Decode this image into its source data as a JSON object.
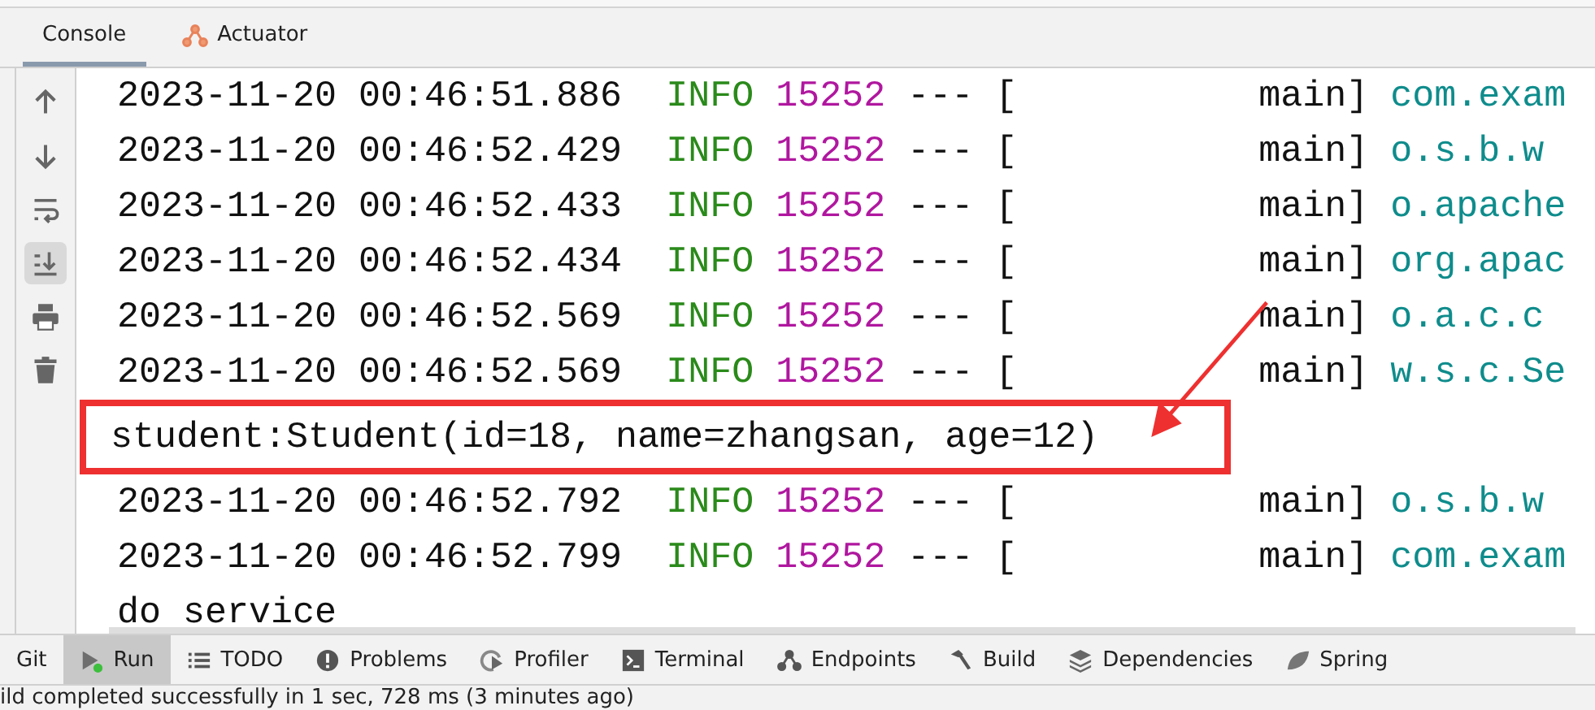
{
  "tabs": [
    {
      "label": "Console",
      "selected": true
    },
    {
      "label": "Actuator",
      "selected": false
    }
  ],
  "toolbar": [
    {
      "kind": "up",
      "on": false
    },
    {
      "kind": "down",
      "on": false
    },
    {
      "kind": "wrap",
      "on": false
    },
    {
      "kind": "scroll-end",
      "on": true
    },
    {
      "kind": "print",
      "on": false
    },
    {
      "kind": "trash",
      "on": false
    }
  ],
  "lines": [
    {
      "kind": "log",
      "highlighted": false,
      "time": "2023-11-20 00:46:51.886",
      "level": "INFO",
      "pid": "15252",
      "thread": "--- [           main]",
      "logger": "com.exam"
    },
    {
      "kind": "log",
      "highlighted": false,
      "time": "2023-11-20 00:46:52.429",
      "level": "INFO",
      "pid": "15252",
      "thread": "--- [           main]",
      "logger": "o.s.b.w"
    },
    {
      "kind": "log",
      "highlighted": false,
      "time": "2023-11-20 00:46:52.433",
      "level": "INFO",
      "pid": "15252",
      "thread": "--- [           main]",
      "logger": "o.apache"
    },
    {
      "kind": "log",
      "highlighted": false,
      "time": "2023-11-20 00:46:52.434",
      "level": "INFO",
      "pid": "15252",
      "thread": "--- [           main]",
      "logger": "org.apac"
    },
    {
      "kind": "log",
      "highlighted": false,
      "time": "2023-11-20 00:46:52.569",
      "level": "INFO",
      "pid": "15252",
      "thread": "--- [           main]",
      "logger": "o.a.c.c"
    },
    {
      "kind": "log",
      "highlighted": false,
      "time": "2023-11-20 00:46:52.569",
      "level": "INFO",
      "pid": "15252",
      "thread": "--- [           main]",
      "logger": "w.s.c.Se"
    },
    {
      "kind": "plain",
      "highlighted": true,
      "text": "student:Student(id=18, name=zhangsan, age=12)"
    },
    {
      "kind": "log",
      "highlighted": false,
      "time": "2023-11-20 00:46:52.792",
      "level": "INFO",
      "pid": "15252",
      "thread": "--- [           main]",
      "logger": "o.s.b.w"
    },
    {
      "kind": "log",
      "highlighted": false,
      "time": "2023-11-20 00:46:52.799",
      "level": "INFO",
      "pid": "15252",
      "thread": "--- [           main]",
      "logger": "com.exam"
    },
    {
      "kind": "plain",
      "highlighted": false,
      "text": "do service"
    }
  ],
  "bottom_tabs": [
    {
      "label": "Git",
      "selected": false
    },
    {
      "label": "Run",
      "selected": true
    },
    {
      "label": "TODO",
      "selected": false
    },
    {
      "label": "Problems",
      "selected": false
    },
    {
      "label": "Profiler",
      "selected": false
    },
    {
      "label": "Terminal",
      "selected": false
    },
    {
      "label": "Endpoints",
      "selected": false
    },
    {
      "label": "Build",
      "selected": false
    },
    {
      "label": "Dependencies",
      "selected": false
    },
    {
      "label": "Spring",
      "selected": false
    }
  ],
  "status_bar": {
    "text": "ild completed successfully in 1 sec, 728 ms (3 minutes ago)"
  }
}
